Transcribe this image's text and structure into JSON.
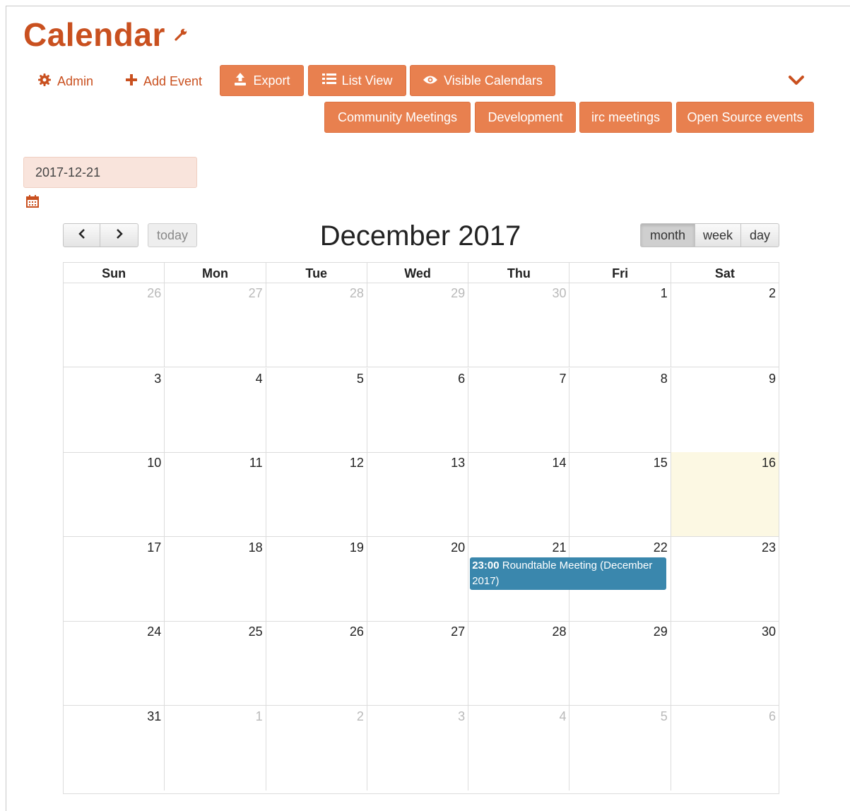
{
  "header": {
    "title": "Calendar",
    "admin_label": "Admin",
    "add_event_label": "Add Event",
    "export_label": "Export",
    "list_view_label": "List View",
    "visible_calendars_label": "Visible Calendars",
    "calendars": [
      "Community Meetings",
      "Development",
      "irc meetings",
      "Open Source events"
    ]
  },
  "date_picker": {
    "value": "2017-12-21"
  },
  "calendar": {
    "title": "December 2017",
    "today_label": "today",
    "views": [
      "month",
      "week",
      "day"
    ],
    "active_view": "month",
    "weekdays": [
      "Sun",
      "Mon",
      "Tue",
      "Wed",
      "Thu",
      "Fri",
      "Sat"
    ],
    "weeks": [
      [
        "26",
        "27",
        "28",
        "29",
        "30",
        "1",
        "2"
      ],
      [
        "3",
        "4",
        "5",
        "6",
        "7",
        "8",
        "9"
      ],
      [
        "10",
        "11",
        "12",
        "13",
        "14",
        "15",
        "16"
      ],
      [
        "17",
        "18",
        "19",
        "20",
        "21",
        "22",
        "23"
      ],
      [
        "24",
        "25",
        "26",
        "27",
        "28",
        "29",
        "30"
      ],
      [
        "31",
        "1",
        "2",
        "3",
        "4",
        "5",
        "6"
      ]
    ],
    "highlighted_day": "16",
    "event": {
      "time": "23:00",
      "title": "Roundtable Meeting (December 2017)"
    }
  },
  "colors": {
    "brand": "#c9501f",
    "button": "#e8804f",
    "event": "#3a87ad",
    "today_highlight": "#fcf8e3"
  },
  "icons": [
    "wrench-icon",
    "gear-icon",
    "plus-icon",
    "upload-icon",
    "list-icon",
    "eye-icon",
    "chevron-down-icon",
    "calendar-icon",
    "chevron-left-icon",
    "chevron-right-icon"
  ]
}
